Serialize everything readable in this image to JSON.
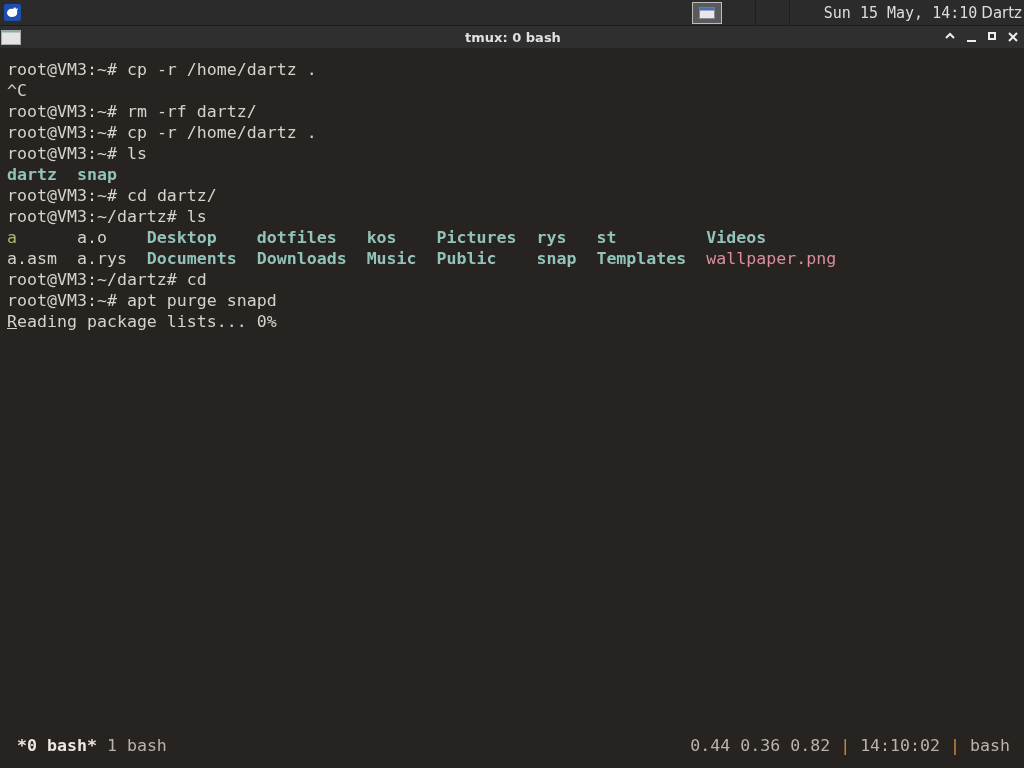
{
  "panel": {
    "taskbar": [
      {
        "selected": true
      }
    ],
    "clock": "Sun 15 May, 14:10",
    "user": "Dartz"
  },
  "window": {
    "title": "tmux: 0 bash"
  },
  "terminal": {
    "lines": [
      {
        "kind": "command",
        "prompt": "root@VM3:~#",
        "command": "cp -r /home/dartz .",
        "cursor": false
      },
      {
        "kind": "output",
        "text": "^C",
        "cursor": false
      },
      {
        "kind": "command",
        "prompt": "root@VM3:~#",
        "command": "rm -rf dartz/",
        "cursor": false
      },
      {
        "kind": "command",
        "prompt": "root@VM3:~#",
        "command": "cp -r /home/dartz .",
        "cursor": false
      },
      {
        "kind": "command",
        "prompt": "root@VM3:~#",
        "command": "ls",
        "cursor": false
      },
      {
        "kind": "listing",
        "cursor": false,
        "rows": [
          [
            {
              "name": "dartz",
              "kind": "dir"
            },
            {
              "name": "snap",
              "kind": "dir"
            }
          ]
        ]
      },
      {
        "kind": "command",
        "prompt": "root@VM3:~#",
        "command": "cd dartz/",
        "cursor": false
      },
      {
        "kind": "command",
        "prompt": "root@VM3:~/dartz#",
        "command": "ls",
        "cursor": false
      },
      {
        "kind": "listing",
        "cursor": false,
        "rows": [
          [
            {
              "name": "a",
              "kind": "exec"
            },
            {
              "name": "a.o",
              "kind": "file"
            },
            {
              "name": "Desktop",
              "kind": "dir"
            },
            {
              "name": "dotfiles",
              "kind": "dir"
            },
            {
              "name": "kos",
              "kind": "dir"
            },
            {
              "name": "Pictures",
              "kind": "dir"
            },
            {
              "name": "rys",
              "kind": "dir"
            },
            {
              "name": "st",
              "kind": "dir"
            },
            {
              "name": "Videos",
              "kind": "dir"
            }
          ],
          [
            {
              "name": "a.asm",
              "kind": "file"
            },
            {
              "name": "a.rys",
              "kind": "file"
            },
            {
              "name": "Documents",
              "kind": "dir"
            },
            {
              "name": "Downloads",
              "kind": "dir"
            },
            {
              "name": "Music",
              "kind": "dir"
            },
            {
              "name": "Public",
              "kind": "dir"
            },
            {
              "name": "snap",
              "kind": "dir"
            },
            {
              "name": "Templates",
              "kind": "dir"
            },
            {
              "name": "wallpaper.png",
              "kind": "image"
            }
          ]
        ]
      },
      {
        "kind": "command",
        "prompt": "root@VM3:~/dartz#",
        "command": "cd",
        "cursor": false
      },
      {
        "kind": "command",
        "prompt": "root@VM3:~#",
        "command": "apt purge snapd",
        "cursor": false
      },
      {
        "kind": "output",
        "text": "Reading package lists... 0%",
        "cursor": true
      }
    ]
  },
  "status_bar": {
    "windows": [
      {
        "label": "*0 bash*",
        "selected": true
      },
      {
        "label": "1 bash",
        "selected": false
      }
    ],
    "load": "0.44 0.36 0.82",
    "separators": [
      "|",
      "|"
    ],
    "time": "14:10:02",
    "program": "bash"
  }
}
